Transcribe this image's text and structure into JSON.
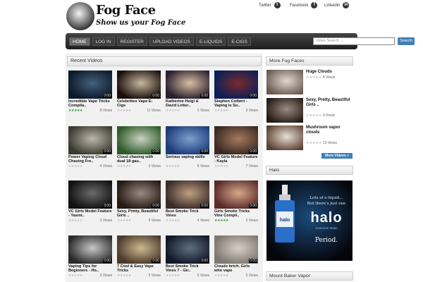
{
  "header": {
    "logo_title": "Fog Face",
    "logo_subtitle": "Show us your Fog Face",
    "social": [
      {
        "label": "Twitter",
        "icon": "twitter-icon",
        "glyph": "t"
      },
      {
        "label": "Facebook",
        "icon": "facebook-icon",
        "glyph": "f"
      },
      {
        "label": "Linkedin",
        "icon": "linkedin-icon",
        "glyph": "in"
      }
    ]
  },
  "nav": {
    "items": [
      "HOME",
      "LOG IN",
      "REGISTER",
      "UPLOAD VIDEOS",
      "E-LIQUIDS",
      "E-CIGS"
    ],
    "active": "HOME",
    "search_placeholder": "Video Search ...",
    "search_button": "Search"
  },
  "recent": {
    "title": "Recent Videos",
    "videos": [
      {
        "title": "Incredible Vape Tricks Compila..",
        "views": "8 Views",
        "duration": "0:00",
        "rated": true,
        "colors": [
          "#0b1a2a",
          "#44607a"
        ]
      },
      {
        "title": "Celebrities Vape E-Cigs",
        "views": "11 Views",
        "duration": "0:00",
        "rated": false,
        "colors": [
          "#1a0f0a",
          "#c8b8a0"
        ]
      },
      {
        "title": "Katherine Heigl & David Letter..",
        "views": "2 Views",
        "duration": "0:00",
        "rated": false,
        "colors": [
          "#2a2030",
          "#d9c0a0"
        ]
      },
      {
        "title": "Stephen Colbert - Vaping Is So..",
        "views": "3 Views",
        "duration": "0:00",
        "rated": false,
        "colors": [
          "#0a1e5a",
          "#7a2a2a"
        ]
      },
      {
        "title": "Power Vaping Cloud Chasing Fre..",
        "views": "4 Views",
        "duration": "0:00",
        "rated": false,
        "colors": [
          "#3a3a30",
          "#bdb8aa"
        ]
      },
      {
        "title": "Cloud chasing with dual 18 gau..",
        "views": "2 Views",
        "duration": "0:00",
        "rated": false,
        "colors": [
          "#2e5a28",
          "#c9d2c2"
        ]
      },
      {
        "title": "Serious vaping skills",
        "views": "8 Views",
        "duration": "0:00",
        "rated": false,
        "colors": [
          "#1e3c78",
          "#7aa0d0"
        ]
      },
      {
        "title": "VC Girls Model Feature - Kayla",
        "views": "7 Views",
        "duration": "0:00",
        "rated": false,
        "colors": [
          "#3a2a22",
          "#a77a60"
        ]
      },
      {
        "title": "VC Girls Model Feature - Yasmi..",
        "views": "3 Views",
        "duration": "0:00",
        "rated": false,
        "colors": [
          "#101010",
          "#6a6a6a"
        ]
      },
      {
        "title": "Sexy, Pretty, Beautiful Girls ..",
        "views": "9 Views",
        "duration": "0:00",
        "rated": false,
        "colors": [
          "#241a14",
          "#9a8a80"
        ]
      },
      {
        "title": "Best Smoke Trick Vines",
        "views": "4 Views",
        "duration": "0:00",
        "rated": false,
        "colors": [
          "#3a2a2a",
          "#c0a080"
        ]
      },
      {
        "title": "Girls Smoke Tricks Vine Compil..",
        "views": "2 Views",
        "duration": "0:00",
        "rated": true,
        "colors": [
          "#5a2a2a",
          "#d8a88a"
        ]
      },
      {
        "title": "Vaping Tips for Beginners - Ho..",
        "views": "3 Views",
        "duration": "0:00",
        "rated": false,
        "colors": [
          "#2a2a2a",
          "#c8c8c8"
        ]
      },
      {
        "title": "7 Cool & Easy Vape Tricks",
        "views": "5 Views",
        "duration": "0:00",
        "rated": false,
        "colors": [
          "#4a3a2a",
          "#d0b890"
        ]
      },
      {
        "title": "Best Smoke Trick Vines 7 - Gir..",
        "views": "6 Views",
        "duration": "0:00",
        "rated": false,
        "colors": [
          "#101828",
          "#607080"
        ]
      },
      {
        "title": "Clouds hrtch. Girls who vape",
        "views": "5 Views",
        "duration": "0:00",
        "rated": false,
        "colors": [
          "#807870",
          "#d8d0c8"
        ]
      }
    ]
  },
  "sidebar": {
    "more_title": "More Fog Faces",
    "faces": [
      {
        "title": "Huge Clouds",
        "views": "8 Views",
        "colors": [
          "#6a5a50",
          "#e0d8d0"
        ]
      },
      {
        "title": "Sexy, Pretty, Beautiful Girls ..",
        "views": "9 Views",
        "colors": [
          "#241a14",
          "#9a8a80"
        ]
      },
      {
        "title": "Mushroom vapor clouds",
        "views": "13 Views",
        "colors": [
          "#5a4030",
          "#e8e0d8"
        ]
      }
    ],
    "more_button": "More Videos »",
    "halo_title": "Halo",
    "ad": {
      "tagline1": "Lots of e-liquid...",
      "tagline2": "But there's just one",
      "brand": "halo",
      "brand_sub": "American Made",
      "end": "Period."
    },
    "mount_baker_title": "Mount Baker Vapor"
  },
  "colors": {
    "accent": "#3f7fb8",
    "star": "#2e9e2e",
    "nav_bg": "#2a2a2a"
  }
}
